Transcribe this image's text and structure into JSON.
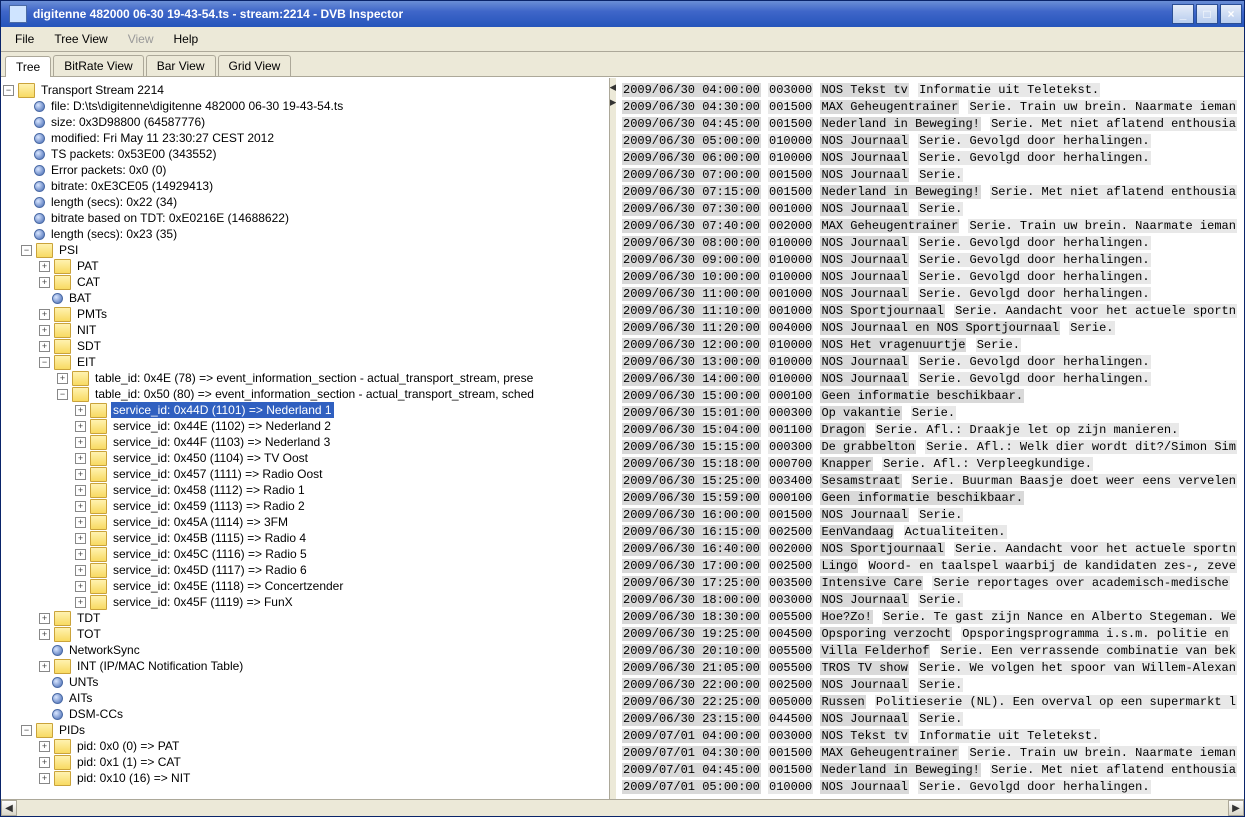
{
  "window": {
    "title": "digitenne 482000 06-30 19-43-54.ts - stream:2214 - DVB Inspector"
  },
  "menu": {
    "file": "File",
    "tree": "Tree View",
    "view": "View",
    "help": "Help"
  },
  "tabs": {
    "tree": "Tree",
    "bitrate": "BitRate View",
    "bar": "Bar View",
    "grid": "Grid View"
  },
  "tree": {
    "root": "Transport Stream 2214",
    "file": "file: D:\\ts\\digitenne\\digitenne 482000 06-30 19-43-54.ts",
    "size": "size: 0x3D98800 (64587776)",
    "modified": "modified: Fri May 11 23:30:27 CEST 2012",
    "tspackets": "TS packets: 0x53E00 (343552)",
    "errorpkts": "Error packets: 0x0 (0)",
    "bitrate": "bitrate: 0xE3CE05 (14929413)",
    "length": "length (secs): 0x22 (34)",
    "bitrate_tdt": "bitrate based on TDT: 0xE0216E (14688622)",
    "length2": "length (secs): 0x23 (35)",
    "psi": {
      "label": "PSI",
      "pat": "PAT",
      "cat": "CAT",
      "bat": "BAT",
      "pmts": "PMTs",
      "nit": "NIT",
      "sdt": "SDT",
      "eit": {
        "label": "EIT",
        "t4e": "table_id: 0x4E (78) => event_information_section - actual_transport_stream, prese",
        "t50": "table_id: 0x50 (80) => event_information_section - actual_transport_stream, sched",
        "services": [
          "service_id: 0x44D (1101) => Nederland 1",
          "service_id: 0x44E (1102) => Nederland 2",
          "service_id: 0x44F (1103) => Nederland 3",
          "service_id: 0x450 (1104) => TV Oost",
          "service_id: 0x457 (1111) => Radio Oost",
          "service_id: 0x458 (1112) => Radio 1",
          "service_id: 0x459 (1113) => Radio 2",
          "service_id: 0x45A (1114) => 3FM",
          "service_id: 0x45B (1115) => Radio 4",
          "service_id: 0x45C (1116) => Radio 5",
          "service_id: 0x45D (1117) => Radio 6",
          "service_id: 0x45E (1118) => Concertzender",
          "service_id: 0x45F (1119) => FunX"
        ]
      },
      "tdt": "TDT",
      "tot": "TOT",
      "networksync": "NetworkSync",
      "int": "INT (IP/MAC Notification Table)",
      "unts": "UNTs",
      "aits": "AITs",
      "dsmcc": "DSM-CCs"
    },
    "pids": {
      "label": "PIDs",
      "p0": "pid: 0x0 (0) => PAT",
      "p1": "pid: 0x1 (1) => CAT",
      "p10": "pid: 0x10 (16) => NIT"
    }
  },
  "events": [
    {
      "dt": "2009/06/30 04:00:00",
      "dur": "003000",
      "segs": [
        [
          "t1",
          "NOS Tekst tv"
        ],
        [
          "tx",
          " "
        ],
        [
          "t2",
          "Informatie uit Teletekst."
        ]
      ]
    },
    {
      "dt": "2009/06/30 04:30:00",
      "dur": "001500",
      "segs": [
        [
          "t1",
          "MAX Geheugentrainer"
        ],
        [
          "tx",
          " "
        ],
        [
          "t2",
          "Serie. Train uw brein. Naarmate ieman"
        ]
      ]
    },
    {
      "dt": "2009/06/30 04:45:00",
      "dur": "001500",
      "segs": [
        [
          "t1",
          "Nederland in Beweging!"
        ],
        [
          "tx",
          " "
        ],
        [
          "t2",
          "Serie. Met niet aflatend enthousia"
        ]
      ]
    },
    {
      "dt": "2009/06/30 05:00:00",
      "dur": "010000",
      "segs": [
        [
          "t1",
          "NOS Journaal"
        ],
        [
          "tx",
          " "
        ],
        [
          "t2",
          "Serie. Gevolgd door herhalingen."
        ]
      ]
    },
    {
      "dt": "2009/06/30 06:00:00",
      "dur": "010000",
      "segs": [
        [
          "t1",
          "NOS Journaal"
        ],
        [
          "tx",
          " "
        ],
        [
          "t2",
          "Serie. Gevolgd door herhalingen."
        ]
      ]
    },
    {
      "dt": "2009/06/30 07:00:00",
      "dur": "001500",
      "segs": [
        [
          "t1",
          "NOS Journaal"
        ],
        [
          "tx",
          " "
        ],
        [
          "t2",
          "Serie."
        ]
      ]
    },
    {
      "dt": "2009/06/30 07:15:00",
      "dur": "001500",
      "segs": [
        [
          "t1",
          "Nederland in Beweging!"
        ],
        [
          "tx",
          " "
        ],
        [
          "t2",
          "Serie. Met niet aflatend enthousia"
        ]
      ]
    },
    {
      "dt": "2009/06/30 07:30:00",
      "dur": "001000",
      "segs": [
        [
          "t1",
          "NOS Journaal"
        ],
        [
          "tx",
          " "
        ],
        [
          "t2",
          "Serie."
        ]
      ]
    },
    {
      "dt": "2009/06/30 07:40:00",
      "dur": "002000",
      "segs": [
        [
          "t1",
          "MAX Geheugentrainer"
        ],
        [
          "tx",
          " "
        ],
        [
          "t2",
          "Serie. Train uw brein. Naarmate ieman"
        ]
      ]
    },
    {
      "dt": "2009/06/30 08:00:00",
      "dur": "010000",
      "segs": [
        [
          "t1",
          "NOS Journaal"
        ],
        [
          "tx",
          " "
        ],
        [
          "t2",
          "Serie. Gevolgd door herhalingen."
        ]
      ]
    },
    {
      "dt": "2009/06/30 09:00:00",
      "dur": "010000",
      "segs": [
        [
          "t1",
          "NOS Journaal"
        ],
        [
          "tx",
          " "
        ],
        [
          "t2",
          "Serie. Gevolgd door herhalingen."
        ]
      ]
    },
    {
      "dt": "2009/06/30 10:00:00",
      "dur": "010000",
      "segs": [
        [
          "t1",
          "NOS Journaal"
        ],
        [
          "tx",
          " "
        ],
        [
          "t2",
          "Serie. Gevolgd door herhalingen."
        ]
      ]
    },
    {
      "dt": "2009/06/30 11:00:00",
      "dur": "001000",
      "segs": [
        [
          "t1",
          "NOS Journaal"
        ],
        [
          "tx",
          " "
        ],
        [
          "t2",
          "Serie. Gevolgd door herhalingen."
        ]
      ]
    },
    {
      "dt": "2009/06/30 11:10:00",
      "dur": "001000",
      "segs": [
        [
          "t1",
          "NOS Sportjournaal"
        ],
        [
          "tx",
          " "
        ],
        [
          "t2",
          "Serie. Aandacht voor het actuele sportn"
        ]
      ]
    },
    {
      "dt": "2009/06/30 11:20:00",
      "dur": "004000",
      "segs": [
        [
          "t1",
          "NOS Journaal en NOS Sportjournaal"
        ],
        [
          "tx",
          " "
        ],
        [
          "t2",
          "Serie."
        ]
      ]
    },
    {
      "dt": "2009/06/30 12:00:00",
      "dur": "010000",
      "segs": [
        [
          "t1",
          "NOS Het vragenuurtje"
        ],
        [
          "tx",
          " "
        ],
        [
          "t2",
          "Serie."
        ]
      ]
    },
    {
      "dt": "2009/06/30 13:00:00",
      "dur": "010000",
      "segs": [
        [
          "t1",
          "NOS Journaal"
        ],
        [
          "tx",
          " "
        ],
        [
          "t2",
          "Serie. Gevolgd door herhalingen."
        ]
      ]
    },
    {
      "dt": "2009/06/30 14:00:00",
      "dur": "010000",
      "segs": [
        [
          "t1",
          "NOS Journaal"
        ],
        [
          "tx",
          " "
        ],
        [
          "t2",
          "Serie. Gevolgd door herhalingen."
        ]
      ]
    },
    {
      "dt": "2009/06/30 15:00:00",
      "dur": "000100",
      "segs": [
        [
          "t1",
          "Geen informatie beschikbaar."
        ]
      ]
    },
    {
      "dt": "2009/06/30 15:01:00",
      "dur": "000300",
      "segs": [
        [
          "t1",
          "Op vakantie"
        ],
        [
          "tx",
          " "
        ],
        [
          "t2",
          "Serie."
        ]
      ]
    },
    {
      "dt": "2009/06/30 15:04:00",
      "dur": "001100",
      "segs": [
        [
          "t1",
          "Dragon"
        ],
        [
          "tx",
          " "
        ],
        [
          "t2",
          "Serie. Afl.: Draakje let op zijn manieren."
        ]
      ]
    },
    {
      "dt": "2009/06/30 15:15:00",
      "dur": "000300",
      "segs": [
        [
          "t1",
          "De grabbelton"
        ],
        [
          "tx",
          " "
        ],
        [
          "t2",
          "Serie. Afl.: Welk dier wordt dit?/Simon Sim"
        ]
      ]
    },
    {
      "dt": "2009/06/30 15:18:00",
      "dur": "000700",
      "segs": [
        [
          "t1",
          "Knapper"
        ],
        [
          "tx",
          " "
        ],
        [
          "t2",
          "Serie. Afl.: Verpleegkundige."
        ]
      ]
    },
    {
      "dt": "2009/06/30 15:25:00",
      "dur": "003400",
      "segs": [
        [
          "t1",
          "Sesamstraat"
        ],
        [
          "tx",
          " "
        ],
        [
          "t2",
          "Serie. Buurman Baasje doet weer eens vervelen"
        ]
      ]
    },
    {
      "dt": "2009/06/30 15:59:00",
      "dur": "000100",
      "segs": [
        [
          "t1",
          "Geen informatie beschikbaar."
        ]
      ]
    },
    {
      "dt": "2009/06/30 16:00:00",
      "dur": "001500",
      "segs": [
        [
          "t1",
          "NOS Journaal"
        ],
        [
          "tx",
          " "
        ],
        [
          "t2",
          "Serie."
        ]
      ]
    },
    {
      "dt": "2009/06/30 16:15:00",
      "dur": "002500",
      "segs": [
        [
          "t1",
          "EenVandaag"
        ],
        [
          "tx",
          " "
        ],
        [
          "t2",
          "Actualiteiten."
        ]
      ]
    },
    {
      "dt": "2009/06/30 16:40:00",
      "dur": "002000",
      "segs": [
        [
          "t1",
          "NOS Sportjournaal"
        ],
        [
          "tx",
          " "
        ],
        [
          "t2",
          "Serie. Aandacht voor het actuele sportn"
        ]
      ]
    },
    {
      "dt": "2009/06/30 17:00:00",
      "dur": "002500",
      "segs": [
        [
          "t1",
          "Lingo"
        ],
        [
          "tx",
          " "
        ],
        [
          "t2",
          "Woord- en taalspel waarbij de kandidaten zes-, zeve"
        ]
      ]
    },
    {
      "dt": "2009/06/30 17:25:00",
      "dur": "003500",
      "segs": [
        [
          "t1",
          "Intensive Care"
        ],
        [
          "tx",
          " "
        ],
        [
          "t2",
          "Serie reportages over academisch-medische"
        ]
      ]
    },
    {
      "dt": "2009/06/30 18:00:00",
      "dur": "003000",
      "segs": [
        [
          "t1",
          "NOS Journaal"
        ],
        [
          "tx",
          " "
        ],
        [
          "t2",
          "Serie."
        ]
      ]
    },
    {
      "dt": "2009/06/30 18:30:00",
      "dur": "005500",
      "segs": [
        [
          "t1",
          "Hoe?Zo!"
        ],
        [
          "tx",
          " "
        ],
        [
          "t2",
          "Serie. Te gast zijn Nance en Alberto Stegeman. We"
        ]
      ]
    },
    {
      "dt": "2009/06/30 19:25:00",
      "dur": "004500",
      "segs": [
        [
          "t1",
          "Opsporing verzocht"
        ],
        [
          "tx",
          " "
        ],
        [
          "t2",
          "Opsporingsprogramma i.s.m. politie en"
        ]
      ]
    },
    {
      "dt": "2009/06/30 20:10:00",
      "dur": "005500",
      "segs": [
        [
          "t1",
          "Villa Felderhof"
        ],
        [
          "tx",
          " "
        ],
        [
          "t2",
          "Serie. Een verrassende combinatie van bek"
        ]
      ]
    },
    {
      "dt": "2009/06/30 21:05:00",
      "dur": "005500",
      "segs": [
        [
          "t1",
          "TROS TV show"
        ],
        [
          "tx",
          " "
        ],
        [
          "t2",
          "Serie. We volgen het spoor van Willem-Alexan"
        ]
      ]
    },
    {
      "dt": "2009/06/30 22:00:00",
      "dur": "002500",
      "segs": [
        [
          "t1",
          "NOS Journaal"
        ],
        [
          "tx",
          " "
        ],
        [
          "t2",
          "Serie."
        ]
      ]
    },
    {
      "dt": "2009/06/30 22:25:00",
      "dur": "005000",
      "segs": [
        [
          "t1",
          "Russen"
        ],
        [
          "tx",
          " "
        ],
        [
          "t2",
          "Politieserie (NL). Een overval op een supermarkt l"
        ]
      ]
    },
    {
      "dt": "2009/06/30 23:15:00",
      "dur": "044500",
      "segs": [
        [
          "t1",
          "NOS Journaal"
        ],
        [
          "tx",
          " "
        ],
        [
          "t2",
          "Serie."
        ]
      ]
    },
    {
      "dt": "2009/07/01 04:00:00",
      "dur": "003000",
      "segs": [
        [
          "t1",
          "NOS Tekst tv"
        ],
        [
          "tx",
          " "
        ],
        [
          "t2",
          "Informatie uit Teletekst."
        ]
      ]
    },
    {
      "dt": "2009/07/01 04:30:00",
      "dur": "001500",
      "segs": [
        [
          "t1",
          "MAX Geheugentrainer"
        ],
        [
          "tx",
          " "
        ],
        [
          "t2",
          "Serie. Train uw brein. Naarmate ieman"
        ]
      ]
    },
    {
      "dt": "2009/07/01 04:45:00",
      "dur": "001500",
      "segs": [
        [
          "t1",
          "Nederland in Beweging!"
        ],
        [
          "tx",
          " "
        ],
        [
          "t2",
          "Serie. Met niet aflatend enthousia"
        ]
      ]
    },
    {
      "dt": "2009/07/01 05:00:00",
      "dur": "010000",
      "segs": [
        [
          "t1",
          "NOS Journaal"
        ],
        [
          "tx",
          " "
        ],
        [
          "t2",
          "Serie. Gevolgd door herhalingen."
        ]
      ]
    }
  ]
}
